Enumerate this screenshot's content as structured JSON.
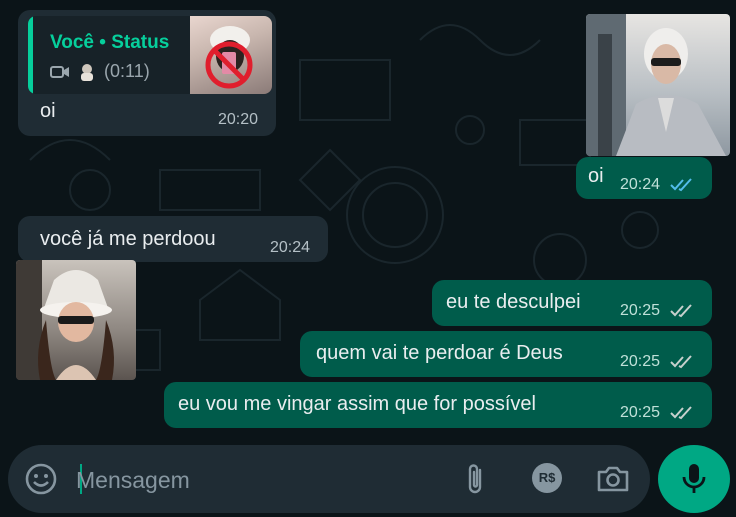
{
  "chat": {
    "m1": {
      "quote_author": "Você • Status",
      "quote_duration": "(0:11)",
      "text": "oi",
      "time": "20:20"
    },
    "m2": {
      "text": "oi",
      "time": "20:24"
    },
    "m3": {
      "text": "você já me perdoou",
      "time": "20:24"
    },
    "m4": {
      "text": "eu te desculpei",
      "time": "20:25"
    },
    "m5": {
      "text": "quem vai te perdoar é Deus",
      "time": "20:25"
    },
    "m6": {
      "text": "eu vou me vingar assim que for possível",
      "time": "20:25"
    }
  },
  "composer": {
    "placeholder": "Mensagem",
    "payment_label": "R$"
  },
  "icons": {
    "emoji": "emoji-icon",
    "attach": "paperclip-icon",
    "payment": "payment-icon",
    "camera": "camera-icon",
    "mic": "microphone-icon",
    "ticks": "double-check-icon",
    "video": "video-camera-icon"
  },
  "colors": {
    "background": "#0b1418",
    "incoming_bubble": "#1f2c34",
    "outgoing_bubble": "#005c4b",
    "accent": "#00a884",
    "read_ticks": "#53bdeb"
  }
}
